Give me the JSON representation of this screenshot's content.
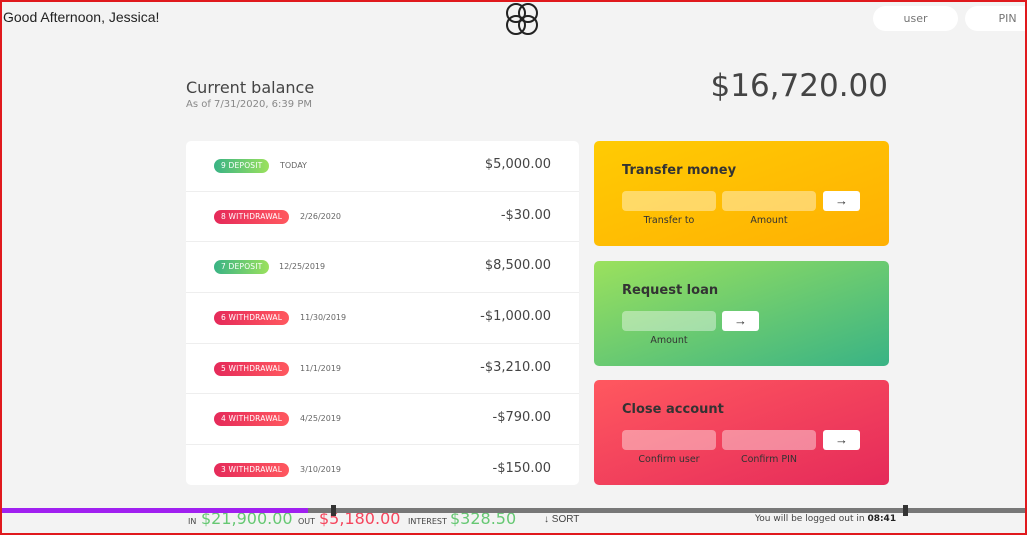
{
  "header": {
    "welcome": "Good Afternoon, Jessica!",
    "login_user_placeholder": "user",
    "login_pin_placeholder": "PIN"
  },
  "balance": {
    "label": "Current balance",
    "date": "As of 7/31/2020, 6:39 PM",
    "value": "$16,720.00"
  },
  "movements": [
    {
      "type_label": "9 DEPOSIT",
      "kind": "deposit",
      "date": "TODAY",
      "value": "$5,000.00"
    },
    {
      "type_label": "8 WITHDRAWAL",
      "kind": "withdrawal",
      "date": "2/26/2020",
      "value": "-$30.00"
    },
    {
      "type_label": "7 DEPOSIT",
      "kind": "deposit",
      "date": "12/25/2019",
      "value": "$8,500.00"
    },
    {
      "type_label": "6 WITHDRAWAL",
      "kind": "withdrawal",
      "date": "11/30/2019",
      "value": "-$1,000.00"
    },
    {
      "type_label": "5 WITHDRAWAL",
      "kind": "withdrawal",
      "date": "11/1/2019",
      "value": "-$3,210.00"
    },
    {
      "type_label": "4 WITHDRAWAL",
      "kind": "withdrawal",
      "date": "4/25/2019",
      "value": "-$790.00"
    },
    {
      "type_label": "3 WITHDRAWAL",
      "kind": "withdrawal",
      "date": "3/10/2019",
      "value": "-$150.00"
    }
  ],
  "operations": {
    "transfer": {
      "title": "Transfer money",
      "field1_label": "Transfer to",
      "field2_label": "Amount",
      "button_icon": "arrow-right-icon"
    },
    "loan": {
      "title": "Request loan",
      "field1_label": "Amount",
      "button_icon": "arrow-right-icon"
    },
    "close": {
      "title": "Close account",
      "field1_label": "Confirm user",
      "field2_label": "Confirm PIN",
      "button_icon": "arrow-right-icon"
    }
  },
  "arrow_glyph": "→",
  "summary": {
    "in_label": "In",
    "in_value": "$21,900.00",
    "out_label": "Out",
    "out_value": "$5,180.00",
    "interest_label": "Interest",
    "interest_value": "$328.50",
    "sort_label": "↓ SORT",
    "logout_text": "You will be logged out in",
    "logout_time": "08:41"
  },
  "colors": {
    "deposit": "#39b385",
    "withdrawal": "#e52a5a",
    "transfer": "#ffb003",
    "loan": "#39b385",
    "close": "#e52a5a",
    "in_value": "#66c873",
    "out_value": "#f5465d"
  },
  "video_progress": 0.3
}
